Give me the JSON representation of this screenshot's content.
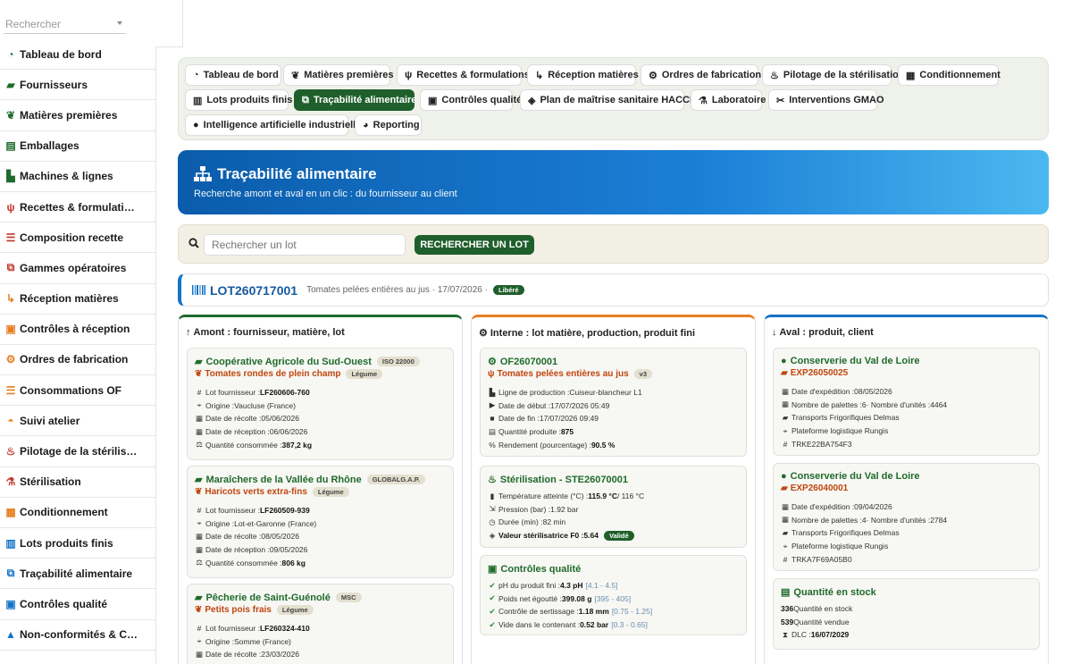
{
  "sidebar": {
    "search_placeholder": "Rechercher",
    "items": [
      {
        "label": "Tableau de bord",
        "icon": "dashboard-icon",
        "color": "#1f6b2b"
      },
      {
        "label": "Fournisseurs",
        "icon": "truck-supplier-icon",
        "color": "#1f6b2b"
      },
      {
        "label": "Matières premières",
        "icon": "seedling-icon",
        "color": "#1f6b2b"
      },
      {
        "label": "Emballages",
        "icon": "box-icon",
        "color": "#1f6b2b"
      },
      {
        "label": "Machines & lignes",
        "icon": "industry-icon",
        "color": "#1f6b2b"
      },
      {
        "label": "Recettes & formulati…",
        "icon": "utensils-icon",
        "color": "#c0392b"
      },
      {
        "label": "Composition recette",
        "icon": "list-icon",
        "color": "#c0392b"
      },
      {
        "label": "Gammes opératoires",
        "icon": "sitemap-icon",
        "color": "#c0392b"
      },
      {
        "label": "Réception matières",
        "icon": "dolly-icon",
        "color": "#e67e22"
      },
      {
        "label": "Contrôles à réception",
        "icon": "clipboard-check-icon",
        "color": "#e67e22"
      },
      {
        "label": "Ordres de fabrication",
        "icon": "gears-icon",
        "color": "#e67e22"
      },
      {
        "label": "Consommations OF",
        "icon": "list-icon",
        "color": "#e67e22"
      },
      {
        "label": "Suivi atelier",
        "icon": "hard-hat-icon",
        "color": "#e67e22"
      },
      {
        "label": "Pilotage de la stérilis…",
        "icon": "fire-icon",
        "color": "#c0392b"
      },
      {
        "label": "Stérilisation",
        "icon": "flask-icon",
        "color": "#c0392b"
      },
      {
        "label": "Conditionnement",
        "icon": "pallet-icon",
        "color": "#e67e22"
      },
      {
        "label": "Lots produits finis",
        "icon": "barcode-icon",
        "color": "#1473c8"
      },
      {
        "label": "Traçabilité alimentaire",
        "icon": "sitemap-icon",
        "color": "#1473c8"
      },
      {
        "label": "Contrôles qualité",
        "icon": "clipboard-check-icon",
        "color": "#1473c8"
      },
      {
        "label": "Non-conformités & C…",
        "icon": "warning-icon",
        "color": "#1473c8"
      }
    ]
  },
  "tabs": [
    {
      "label": "Tableau de bord",
      "icon": "dashboard-icon"
    },
    {
      "label": "Matières premières",
      "icon": "seedling-icon"
    },
    {
      "label": "Recettes & formulations",
      "icon": "utensils-icon"
    },
    {
      "label": "Réception matières",
      "icon": "dolly-icon"
    },
    {
      "label": "Ordres de fabrication",
      "icon": "gears-icon"
    },
    {
      "label": "Pilotage de la stérilisation",
      "icon": "fire-icon"
    },
    {
      "label": "Conditionnement",
      "icon": "pallet-icon"
    },
    {
      "label": "Lots produits finis",
      "icon": "barcode-icon"
    },
    {
      "label": "Traçabilité alimentaire",
      "icon": "sitemap-icon",
      "active": true
    },
    {
      "label": "Contrôles qualité",
      "icon": "clipboard-check-icon"
    },
    {
      "label": "Plan de maîtrise sanitaire HACCP",
      "icon": "shield-icon"
    },
    {
      "label": "Laboratoire",
      "icon": "flask-icon"
    },
    {
      "label": "Interventions GMAO",
      "icon": "tools-icon"
    },
    {
      "label": "Intelligence artificielle industrielle",
      "icon": "lightbulb-icon"
    },
    {
      "label": "Reporting",
      "icon": "chart-pie-icon"
    }
  ],
  "hero": {
    "title": "Traçabilité alimentaire",
    "subtitle": "Recherche amont et aval en un clic : du fournisseur au client"
  },
  "search": {
    "placeholder": "Rechercher un lot",
    "button": "RECHERCHER UN LOT"
  },
  "lot": {
    "code": "LOT260717001",
    "description": "Tomates pelées entières au jus · 17/07/2026 ·",
    "status": "Libéré"
  },
  "columns": {
    "upstream": {
      "title": "Amont : fournisseur, matière, lot",
      "color": "#1f6b2b",
      "cards": [
        {
          "supplier": "Coopérative Agricole du Sud-Ouest",
          "cert": "ISO 22000",
          "material": "Tomates rondes de plein champ",
          "category": "Légume",
          "rows": [
            {
              "label": "Lot fournisseur : ",
              "value": "LF260606-760",
              "bold": true
            },
            {
              "label": "Origine : ",
              "value": "Vaucluse (France)"
            },
            {
              "label": "Date de récolte : ",
              "value": "05/06/2026"
            },
            {
              "label": "Date de réception : ",
              "value": "06/06/2026"
            },
            {
              "label": "Quantité consommée : ",
              "value": "387,2 kg",
              "bold": true
            }
          ]
        },
        {
          "supplier": "Maraîchers de la Vallée du Rhône",
          "cert": "GLOBALG.A.P.",
          "material": "Haricots verts extra-fins",
          "category": "Légume",
          "rows": [
            {
              "label": "Lot fournisseur : ",
              "value": "LF260509-939",
              "bold": true
            },
            {
              "label": "Origine : ",
              "value": "Lot-et-Garonne (France)"
            },
            {
              "label": "Date de récolte : ",
              "value": "08/05/2026"
            },
            {
              "label": "Date de réception : ",
              "value": "09/05/2026"
            },
            {
              "label": "Quantité consommée : ",
              "value": "806 kg",
              "bold": true
            }
          ]
        },
        {
          "supplier": "Pêcherie de Saint-Guénolé",
          "cert": "MSC",
          "material": "Petits pois frais",
          "category": "Légume",
          "rows": [
            {
              "label": "Lot fournisseur : ",
              "value": "LF260324-410",
              "bold": true
            },
            {
              "label": "Origine : ",
              "value": "Somme (France)"
            },
            {
              "label": "Date de récolte : ",
              "value": "23/03/2026"
            }
          ]
        }
      ]
    },
    "internal": {
      "title": "Interne : lot matière, production, produit fini",
      "color": "#e67e22",
      "of": {
        "code": "OF26070001",
        "product": "Tomates pelées entières au jus",
        "version": "v3",
        "rows": [
          {
            "label": "Ligne de production : ",
            "value": "Cuiseur-blancheur L1"
          },
          {
            "label": "Date de début : ",
            "value": "17/07/2026 05:49"
          },
          {
            "label": "Date de fin : ",
            "value": "17/07/2026 09:49"
          },
          {
            "label": "Quantité produite : ",
            "value": "875",
            "bold": true
          },
          {
            "label": "Rendement (pourcentage) : ",
            "value": "90.5 %",
            "bold": true
          }
        ]
      },
      "sterilisation": {
        "title": "Stérilisation - STE26070001",
        "rows": [
          {
            "label": "Température atteinte (°C) : ",
            "value": "115.9 °C",
            "extra": " / 116 °C"
          },
          {
            "label": "Pression (bar) : ",
            "value": "1.92 bar"
          },
          {
            "label": "Durée (min) : ",
            "value": "82 min"
          }
        ],
        "f0_label": "Valeur stérilisatrice F0 : ",
        "f0_value": "5.64",
        "f0_status": "Validé"
      },
      "qc": {
        "title": "Contrôles qualité",
        "rows": [
          {
            "label": "pH du produit fini : ",
            "value": "4.3 pH",
            "range": "[4.1 - 4.5]"
          },
          {
            "label": "Poids net égoutté : ",
            "value": "399.08 g",
            "range": "[395 - 405]"
          },
          {
            "label": "Contrôle de sertissage : ",
            "value": "1.18 mm",
            "range": "[0.75 - 1.25]"
          },
          {
            "label": "Vide dans le contenant : ",
            "value": "0.52 bar",
            "range": "[0.3 - 0.65]"
          }
        ]
      }
    },
    "downstream": {
      "title": "Aval : produit, client",
      "color": "#1473c8",
      "shipments": [
        {
          "client": "Conserverie du Val de Loire",
          "code": "EXP26050025",
          "shipping_date": "08/05/2026",
          "pallets": "6",
          "units": "4464",
          "carrier": "Transports Frigorifiques Delmas",
          "destination": "Plateforme logistique Rungis",
          "tracking": "TRKE22BA754F3"
        },
        {
          "client": "Conserverie du Val de Loire",
          "code": "EXP26040001",
          "shipping_date": "09/04/2026",
          "pallets": "4",
          "units": "2784",
          "carrier": "Transports Frigorifiques Delmas",
          "destination": "Plateforme logistique Rungis",
          "tracking": "TRKA7F69A05B0"
        }
      ],
      "labels": {
        "shipping_date": "Date d'expédition : ",
        "pallets": "Nombre de palettes : ",
        "units": " · Nombre d'unités : "
      },
      "stock": {
        "title": "Quantité en stock",
        "in_stock": "336",
        "in_stock_label": " Quantité en stock",
        "sold": "539",
        "sold_label": " Quantité vendue",
        "dlc_label": "DLC : ",
        "dlc": "16/07/2029"
      }
    }
  }
}
